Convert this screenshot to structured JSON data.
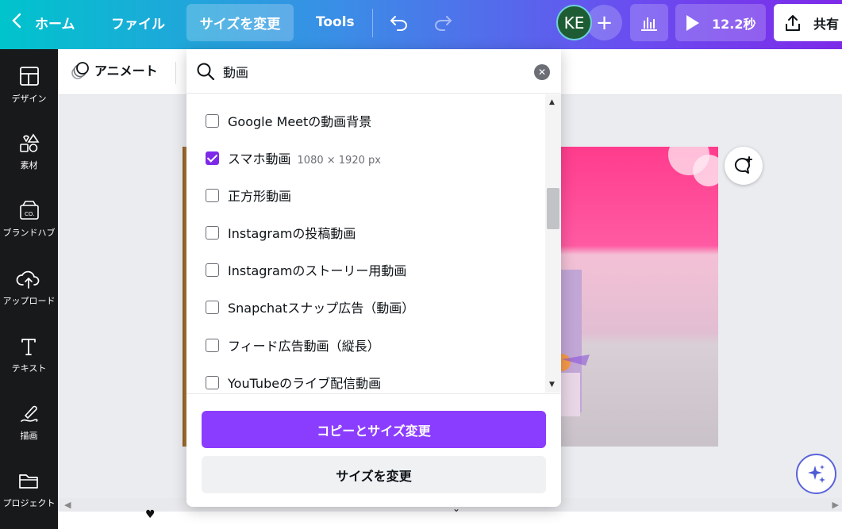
{
  "topbar": {
    "home_label": "ホーム",
    "file_label": "ファイル",
    "resize_label": "サイズを変更",
    "tools_label": "Tools",
    "avatar_initials": "KE",
    "play_duration": "12.2秒",
    "share_label": "共有"
  },
  "sidebar": {
    "items": [
      {
        "label": "デザイン"
      },
      {
        "label": "素材"
      },
      {
        "label": "ブランドハブ"
      },
      {
        "label": "アップロード"
      },
      {
        "label": "テキスト"
      },
      {
        "label": "描画"
      },
      {
        "label": "プロジェクト"
      }
    ]
  },
  "subbar": {
    "animate_label": "アニメート"
  },
  "dropdown": {
    "search_value": "動画",
    "options": [
      {
        "label": "Google Meetの動画背景",
        "dims": "",
        "checked": false
      },
      {
        "label": "スマホ動画",
        "dims": "1080 × 1920 px",
        "checked": true
      },
      {
        "label": "正方形動画",
        "dims": "",
        "checked": false
      },
      {
        "label": "Instagramの投稿動画",
        "dims": "",
        "checked": false
      },
      {
        "label": "Instagramのストーリー用動画",
        "dims": "",
        "checked": false
      },
      {
        "label": "Snapchatスナップ広告（動画）",
        "dims": "",
        "checked": false
      },
      {
        "label": "フィード広告動画（縦長）",
        "dims": "",
        "checked": false
      },
      {
        "label": "YouTubeのライブ配信動画",
        "dims": "",
        "checked": false
      }
    ],
    "copy_resize_label": "コピーとサイズ変更",
    "resize_label": "サイズを変更"
  },
  "colors": {
    "accent": "#8b3dff",
    "checked": "#7d2ae8"
  }
}
